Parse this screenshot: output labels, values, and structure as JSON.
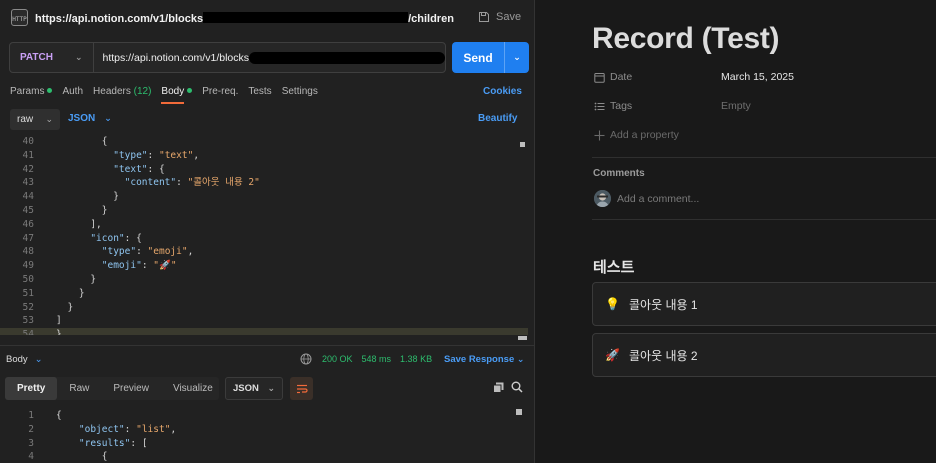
{
  "postman": {
    "title_url_prefix": "https://api.notion.com/v1/blocks",
    "title_url_suffix": "/children",
    "save_label": "Save",
    "http_badge": "HTTP",
    "method": "PATCH",
    "request_url": "https://api.notion.com/v1/blocks",
    "send_label": "Send",
    "tabs": [
      {
        "label": "Params",
        "dot": true
      },
      {
        "label": "Auth"
      },
      {
        "label": "Headers",
        "count": "(12)"
      },
      {
        "label": "Body",
        "dot": true,
        "active": true
      },
      {
        "label": "Pre-req."
      },
      {
        "label": "Tests"
      },
      {
        "label": "Settings"
      }
    ],
    "cookies_label": "Cookies",
    "body_mode": "raw",
    "body_lang": "JSON",
    "beautify_label": "Beautify",
    "code_lines": [
      {
        "n": "40",
        "indent": "        ",
        "tokens": [
          [
            "p",
            "{"
          ]
        ]
      },
      {
        "n": "41",
        "indent": "          ",
        "tokens": [
          [
            "k",
            "\"type\""
          ],
          [
            "p",
            ": "
          ],
          [
            "s",
            "\"text\""
          ],
          [
            "p",
            ","
          ]
        ]
      },
      {
        "n": "42",
        "indent": "          ",
        "tokens": [
          [
            "k",
            "\"text\""
          ],
          [
            "p",
            ": {"
          ]
        ]
      },
      {
        "n": "43",
        "indent": "            ",
        "tokens": [
          [
            "k",
            "\"content\""
          ],
          [
            "p",
            ": "
          ],
          [
            "s",
            "\"콜아웃 내용 2\""
          ]
        ]
      },
      {
        "n": "44",
        "indent": "          ",
        "tokens": [
          [
            "p",
            "}"
          ]
        ]
      },
      {
        "n": "45",
        "indent": "        ",
        "tokens": [
          [
            "p",
            "}"
          ]
        ]
      },
      {
        "n": "46",
        "indent": "      ",
        "tokens": [
          [
            "p",
            "],"
          ]
        ]
      },
      {
        "n": "47",
        "indent": "      ",
        "tokens": [
          [
            "k",
            "\"icon\""
          ],
          [
            "p",
            ": {"
          ]
        ]
      },
      {
        "n": "48",
        "indent": "        ",
        "tokens": [
          [
            "k",
            "\"type\""
          ],
          [
            "p",
            ": "
          ],
          [
            "s",
            "\"emoji\""
          ],
          [
            "p",
            ","
          ]
        ]
      },
      {
        "n": "49",
        "indent": "        ",
        "tokens": [
          [
            "k",
            "\"emoji\""
          ],
          [
            "p",
            ": "
          ],
          [
            "s",
            "\"🚀\""
          ]
        ]
      },
      {
        "n": "50",
        "indent": "      ",
        "tokens": [
          [
            "p",
            "}"
          ]
        ]
      },
      {
        "n": "51",
        "indent": "    ",
        "tokens": [
          [
            "p",
            "}"
          ]
        ]
      },
      {
        "n": "52",
        "indent": "  ",
        "tokens": [
          [
            "p",
            "}"
          ]
        ]
      },
      {
        "n": "53",
        "indent": "",
        "tokens": [
          [
            "p",
            "]"
          ]
        ]
      },
      {
        "n": "54",
        "indent": "",
        "tokens": [
          [
            "p",
            "}"
          ]
        ],
        "highlight": true
      }
    ],
    "response": {
      "body_label": "Body",
      "status": "200 OK",
      "time": "548 ms",
      "size": "1.38 KB",
      "save_response_label": "Save Response",
      "view_tabs": [
        "Pretty",
        "Raw",
        "Preview",
        "Visualize"
      ],
      "active_view": "Pretty",
      "format": "JSON",
      "code_lines": [
        {
          "n": "1",
          "indent": "",
          "tokens": [
            [
              "p",
              "{"
            ]
          ]
        },
        {
          "n": "2",
          "indent": "    ",
          "tokens": [
            [
              "k",
              "\"object\""
            ],
            [
              "p",
              ": "
            ],
            [
              "s",
              "\"list\""
            ],
            [
              "p",
              ","
            ]
          ]
        },
        {
          "n": "3",
          "indent": "    ",
          "tokens": [
            [
              "k",
              "\"results\""
            ],
            [
              "p",
              ": ["
            ]
          ]
        },
        {
          "n": "4",
          "indent": "        ",
          "tokens": [
            [
              "p",
              "{"
            ]
          ]
        }
      ]
    }
  },
  "notion": {
    "page_title": "Record (Test)",
    "properties": [
      {
        "icon": "calendar-icon",
        "name": "Date",
        "value": "March 15, 2025",
        "empty": false
      },
      {
        "icon": "list-icon",
        "name": "Tags",
        "value": "Empty",
        "empty": true
      }
    ],
    "add_property_label": "Add a property",
    "comments_label": "Comments",
    "add_comment_placeholder": "Add a comment...",
    "heading": "테스트",
    "callouts": [
      {
        "emoji": "💡",
        "text": "콜아웃 내용 1"
      },
      {
        "emoji": "🚀",
        "text": "콜아웃 내용 2"
      }
    ]
  },
  "colors": {
    "send_blue": "#1f7ff0",
    "link_blue": "#4a9cf5",
    "status_green": "#2dbd6e",
    "method_purple": "#c9a0f5",
    "active_tab_orange": "#f26b3a"
  }
}
